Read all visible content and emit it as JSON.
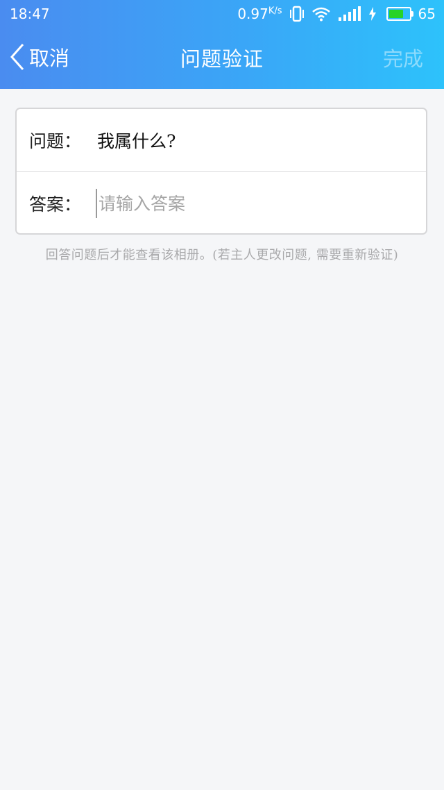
{
  "status_bar": {
    "time": "18:47",
    "network_speed": "0.97",
    "speed_unit": "K/s",
    "battery_level": "65"
  },
  "nav": {
    "back_label": "取消",
    "title": "问题验证",
    "done_label": "完成"
  },
  "form": {
    "question_label": "问题：",
    "question_value": "我属什么?",
    "answer_label": "答案：",
    "answer_value": "",
    "answer_placeholder": "请输入答案"
  },
  "hint": "回答问题后才能查看该相册。(若主人更改问题, 需要重新验证)",
  "colors": {
    "header_gradient_start": "#4a8cf0",
    "header_gradient_end": "#2dc2fb",
    "background": "#f5f6f8",
    "battery_fill": "#27d327"
  },
  "icons": [
    "chevron-left-icon",
    "vibrate-icon",
    "wifi-icon",
    "signal-icon",
    "charging-icon",
    "battery-icon"
  ]
}
